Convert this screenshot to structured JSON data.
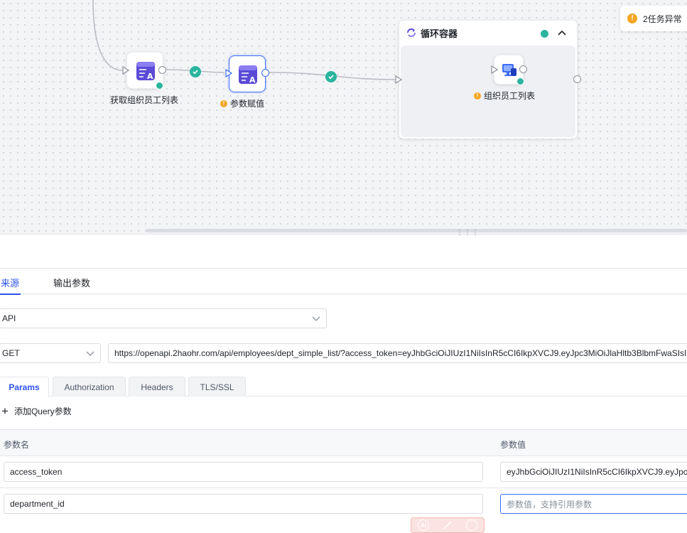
{
  "canvas": {
    "nodes": [
      {
        "label": "获取组织员工列表",
        "warning": false
      },
      {
        "label": "参数赋值",
        "warning": true
      }
    ],
    "loop": {
      "title": "循环容器",
      "inner_node_label": "组织员工列表"
    },
    "task_status": "2任务异常"
  },
  "panel": {
    "tabs": [
      "来源",
      "输出参数"
    ],
    "source_type": "API",
    "method": "GET",
    "url": "https://openapi.2haohr.com/api/employees/dept_simple_list/?access_token=eyJhbGciOiJIUzI1NiIsInR5cCI6IkpXVCJ9.eyJpc3MiOiJlaHltb3BlbmFwaSIsI",
    "subtabs": [
      "Params",
      "Authorization",
      "Headers",
      "TLS/SSL"
    ],
    "add_query_label": "添加Query参数",
    "table": {
      "col_name": "参数名",
      "col_value": "参数值",
      "rows": [
        {
          "name": "access_token",
          "value": "eyJhbGciOiJIUzI1NiIsInR5cCI6IkpXVCJ9.eyJpc"
        },
        {
          "name": "department_id",
          "value": "",
          "placeholder": "参数值，支持引用参数"
        }
      ]
    }
  },
  "ai_toolbar": {
    "label": "AI"
  },
  "colors": {
    "accent": "#2f54eb",
    "success": "#2bb59e",
    "warning": "#f5a623",
    "node_icon": "#5b4bd6"
  }
}
